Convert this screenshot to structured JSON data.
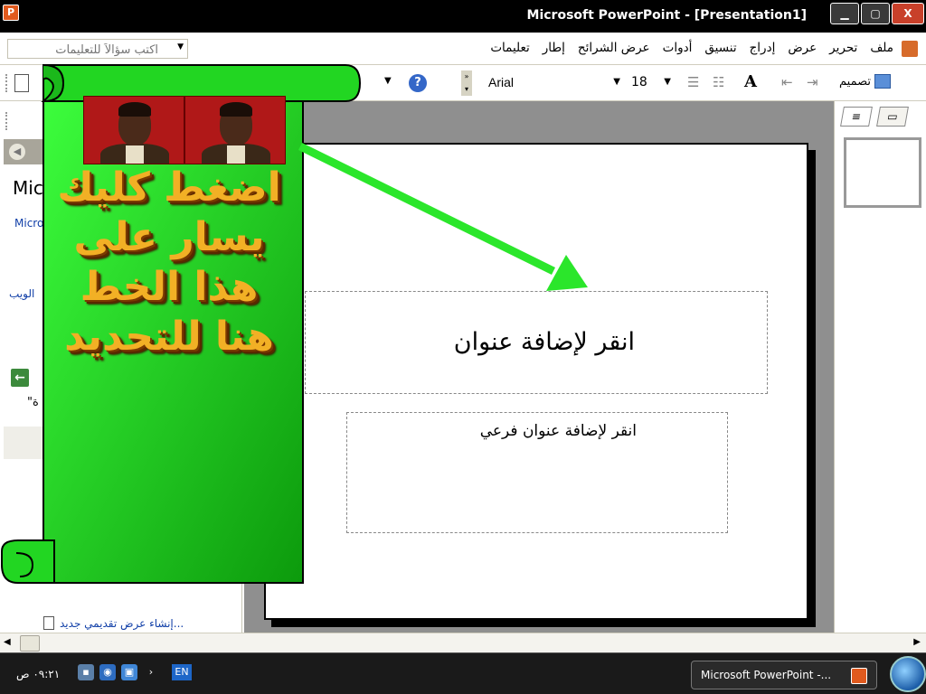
{
  "titlebar": {
    "title": "Microsoft PowerPoint - [Presentation1]",
    "min_label": "▁",
    "max_label": "▢",
    "close_label": "X"
  },
  "menubar": {
    "ask_placeholder": "اكتب سؤالاً للتعليمات",
    "items": [
      "ملف",
      "تحرير",
      "عرض",
      "إدراج",
      "تنسيق",
      "أدوات",
      "عرض الشرائح",
      "إطار",
      "تعليمات"
    ]
  },
  "toolbar": {
    "font_name": "Arial",
    "font_size": "18",
    "design_label": "تصميم",
    "help_label": "?"
  },
  "left_pane": {
    "title": "Mic",
    "link1": "Micro",
    "link2": "الويب",
    "text": "\"ة",
    "bottom_link": "إنشاء عرض تقديمي جديد..."
  },
  "slide": {
    "title_placeholder": "انقر لإضافة عنوان",
    "subtitle_placeholder": "انقر لإضافة عنوان فرعي"
  },
  "banner": {
    "text": "اضغط كليك يسار على هذا الخط هنا للتحديد",
    "colors": {
      "green": "#22CC22",
      "text_gold": "#F2B025",
      "arrow": "#2BE62B"
    }
  },
  "taskbar": {
    "time": "٠٩:٢١ ص",
    "lang": "EN",
    "task_label": "Microsoft PowerPoint -..."
  }
}
